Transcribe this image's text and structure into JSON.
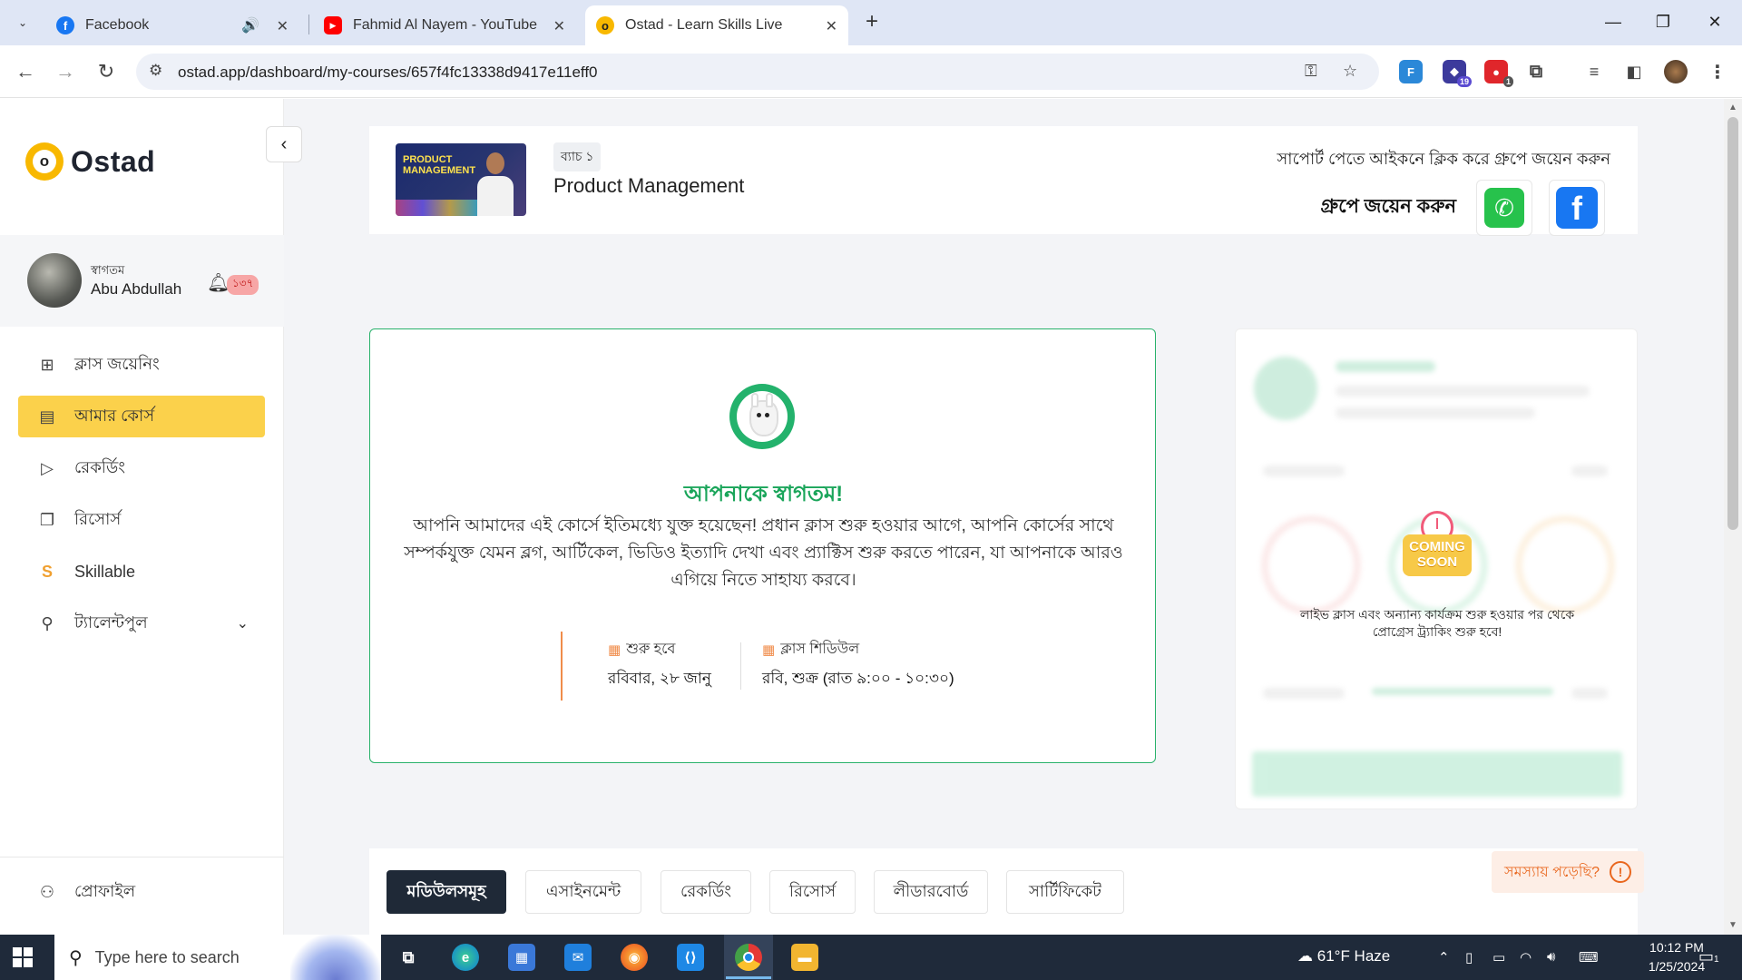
{
  "browser": {
    "tabs": [
      {
        "title": "Facebook",
        "favicon": "facebook-icon",
        "color": "#1877f2",
        "glyph": "f"
      },
      {
        "title": "Fahmid Al Nayem - YouTube",
        "favicon": "youtube-icon",
        "color": "#ff0000",
        "glyph": "▶"
      },
      {
        "title": "Ostad - Learn Skills Live",
        "favicon": "ostad-icon",
        "color": "#f8b800",
        "glyph": "o"
      }
    ],
    "url": "ostad.app/dashboard/my-courses/657f4fc13338d9417e11eff0",
    "extensions": [
      {
        "name": "translate-extension-icon",
        "label": "F",
        "color": "#2b88d8"
      },
      {
        "name": "hat-extension-icon",
        "label": "",
        "badge": "19",
        "color": "#3c3a9c"
      },
      {
        "name": "red-extension-icon",
        "label": "",
        "badge": "1",
        "color": "#e0262b"
      }
    ]
  },
  "sidebar": {
    "brand": "Ostad",
    "collapse_glyph": "‹",
    "greeting": "স্বাগতম",
    "user_name": "Abu Abdullah",
    "notification_count": "১৩৭",
    "menu": [
      {
        "label": "ক্লাস জয়েনিং",
        "icon": "video-plus-icon",
        "glyph": "⊞"
      },
      {
        "label": "আমার কোর্স",
        "icon": "book-icon",
        "glyph": "▤",
        "active": true
      },
      {
        "label": "রেকর্ডিং",
        "icon": "play-icon",
        "glyph": "▷"
      },
      {
        "label": "রিসোর্স",
        "icon": "copy-icon",
        "glyph": "❐"
      },
      {
        "label": "Skillable",
        "icon": "skillable-icon",
        "glyph": "S"
      },
      {
        "label": "ট্যালেন্টপুল",
        "icon": "person-star-icon",
        "glyph": "⚲"
      }
    ],
    "profile_label": "প্রোফাইল"
  },
  "course": {
    "thumb_text": "PRODUCT MANAGEMENT",
    "batch": "ব্যাচ ১",
    "title": "Product Management",
    "support_note": "সাপোর্ট পেতে আইকনে ক্লিক করে গ্রুপে জয়েন করুন",
    "join_label": "গ্রুপে জয়েন করুন"
  },
  "welcome": {
    "title": "আপনাকে স্বাগতম!",
    "body": "আপনি আমাদের এই কোর্সে ইতিমধ্যে যুক্ত হয়েছেন! প্রধান ক্লাস শুরু হওয়ার আগে, আপনি কোর্সের সাথে সম্পর্কযুক্ত যেমন ব্লগ, আর্টিকেল, ভিডিও ইত্যাদি দেখা এবং প্র্যাক্টিস শুরু করতে পারেন, যা আপনাকে আরও এগিয়ে নিতে সাহায্য করবে।",
    "start_label": "শুরু হবে",
    "start_value": "রবিবার, ২৮ জানু",
    "schedule_label": "ক্লাস শিডিউল",
    "schedule_value": "রবি, শুক্র (রাত ৯:০০ - ১০:৩০)"
  },
  "progress": {
    "coming_soon": "COMING SOON",
    "note": "লাইভ ক্লাস এবং অন্যান্য কার্যক্রম শুরু হওয়ার পর থেকে প্রোগ্রেস ট্র্যাকিং শুরু হবে!"
  },
  "help": {
    "label": "সমস্যায় পড়েছি?"
  },
  "bottom_tabs": [
    {
      "label": "মডিউলসমূহ",
      "active": true
    },
    {
      "label": "এসাইনমেন্ট"
    },
    {
      "label": "রেকর্ডিং"
    },
    {
      "label": "রিসোর্স"
    },
    {
      "label": "লীডারবোর্ড"
    },
    {
      "label": "সার্টিফিকেট"
    }
  ],
  "taskbar": {
    "search_placeholder": "Type here to search",
    "weather": "61°F  Haze",
    "time": "10:12 PM",
    "date": "1/25/2024",
    "notifications": "1"
  }
}
